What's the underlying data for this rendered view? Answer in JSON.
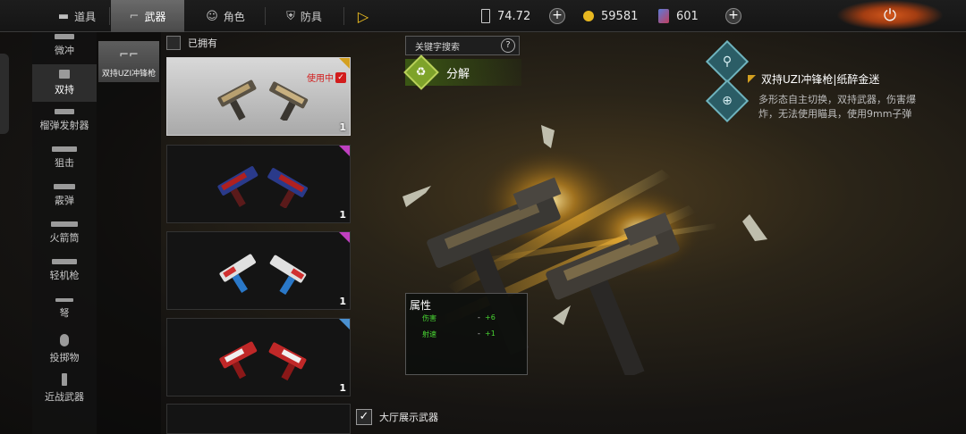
{
  "topbar": {
    "tabs": [
      {
        "label": "道具",
        "icon": "ammo-icon",
        "active": false
      },
      {
        "label": "武器",
        "icon": "pistol-icon",
        "active": true
      },
      {
        "label": "角色",
        "icon": "character-icon",
        "active": false
      },
      {
        "label": "防具",
        "icon": "armor-icon",
        "active": false
      }
    ],
    "play_icon": "play-arrow-icon",
    "resources": [
      {
        "icon": "ticket-icon",
        "value": "74.72",
        "addable": true
      },
      {
        "icon": "gold-coin-icon",
        "value": "59581",
        "addable": false
      },
      {
        "icon": "card-icon",
        "value": "601",
        "addable": true
      }
    ],
    "power_icon": "power-icon",
    "accent_color": "#d4581c"
  },
  "categories": [
    {
      "label": "微冲",
      "active": false
    },
    {
      "label": "双持",
      "active": true
    },
    {
      "label": "榴弹发射器",
      "active": false
    },
    {
      "label": "狙击",
      "active": false
    },
    {
      "label": "霰弹",
      "active": false
    },
    {
      "label": "火箭筒",
      "active": false
    },
    {
      "label": "轻机枪",
      "active": false
    },
    {
      "label": "弩",
      "active": false
    },
    {
      "label": "投掷物",
      "active": false
    },
    {
      "label": "近战武器",
      "active": false
    }
  ],
  "sub_filter": {
    "label": "双持UZI冲锋枪",
    "active": true
  },
  "owned_filter": {
    "label": "已拥有",
    "checked": false
  },
  "skins": [
    {
      "count": "1",
      "selected": true,
      "in_use": true,
      "in_use_label": "使用中",
      "rarity_color": "#d4a020",
      "palette": "gold-black"
    },
    {
      "count": "1",
      "selected": false,
      "in_use": false,
      "rarity_color": "#c040c0",
      "palette": "red-blue"
    },
    {
      "count": "1",
      "selected": false,
      "in_use": false,
      "rarity_color": "#c040c0",
      "palette": "blue-white-red"
    },
    {
      "count": "1",
      "selected": false,
      "in_use": false,
      "rarity_color": "#4a90d0",
      "palette": "red-white"
    }
  ],
  "search": {
    "placeholder": "关键字搜索"
  },
  "dismantle": {
    "label": "分解",
    "icon": "recycle-icon",
    "color": "#7ea32a"
  },
  "detail": {
    "name": "双持UZI冲锋枪|纸醉金迷",
    "description": "多形态自主切换，双持武器，伤害爆炸，无法使用瞄具，使用9mm子弹",
    "rarity_color": "#d4a020"
  },
  "side_buttons": [
    {
      "icon": "character-pose-icon"
    },
    {
      "icon": "zoom-in-icon"
    }
  ],
  "attributes": {
    "title": "属性",
    "items": [
      {
        "name": "伤害",
        "dash": "-",
        "value": "+6"
      },
      {
        "name": "射速",
        "dash": "-",
        "value": "+1"
      }
    ]
  },
  "lobby_display": {
    "label": "大厅展示武器",
    "checked": true
  }
}
